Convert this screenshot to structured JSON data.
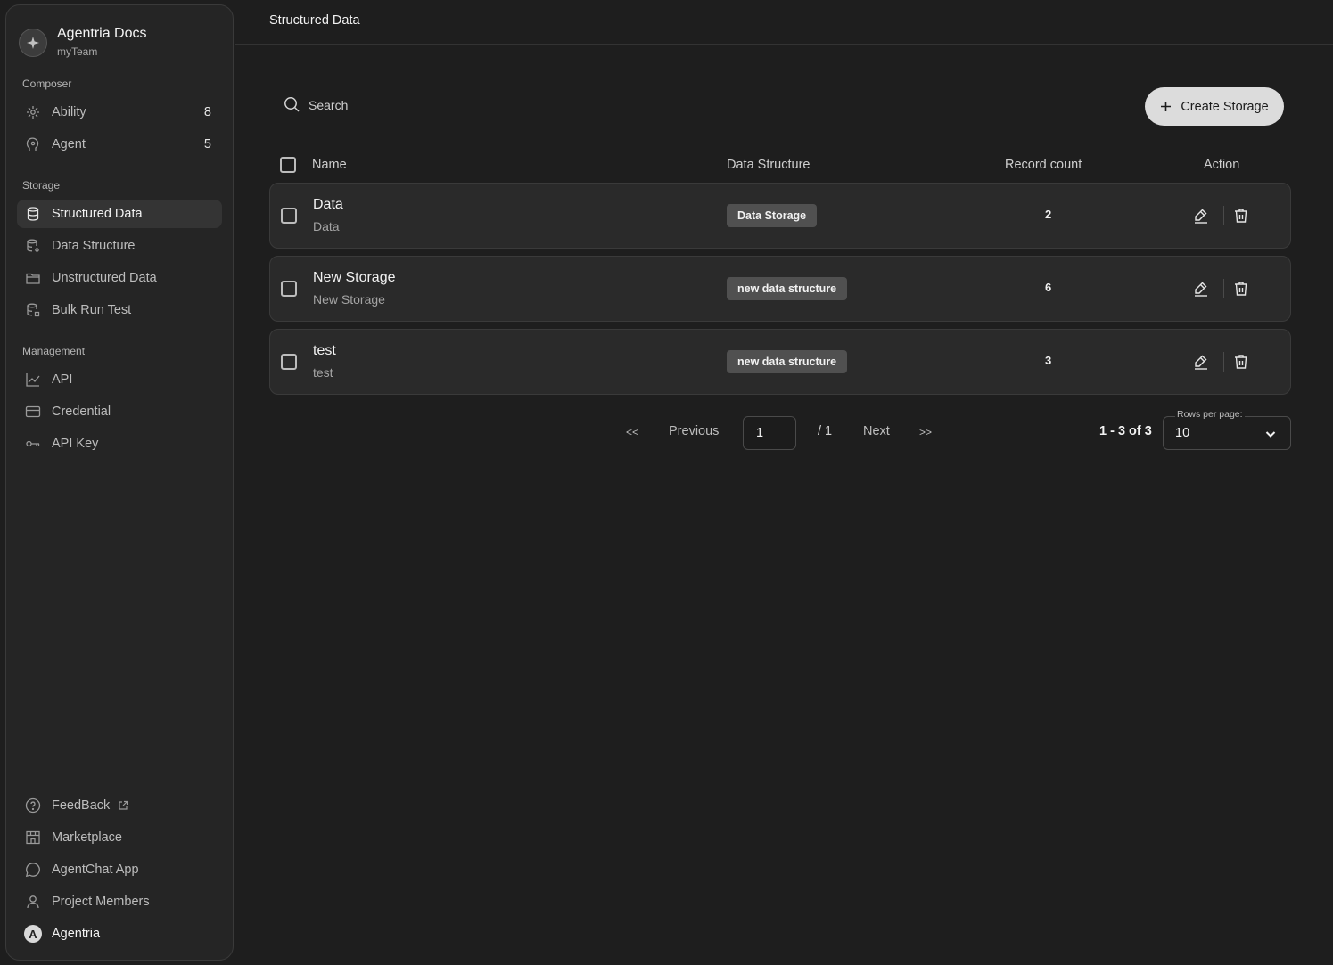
{
  "app": {
    "title": "Agentria Docs",
    "team": "myTeam"
  },
  "sidebar": {
    "composer_label": "Composer",
    "composer": [
      {
        "label": "Ability",
        "count": "8",
        "icon": "ability-icon"
      },
      {
        "label": "Agent",
        "count": "5",
        "icon": "agent-icon"
      }
    ],
    "storage_label": "Storage",
    "storage": [
      {
        "label": "Structured Data",
        "icon": "database-icon",
        "active": true
      },
      {
        "label": "Data Structure",
        "icon": "data-structure-icon"
      },
      {
        "label": "Unstructured Data",
        "icon": "folder-icon"
      },
      {
        "label": "Bulk Run Test",
        "icon": "bulk-run-icon"
      }
    ],
    "management_label": "Management",
    "management": [
      {
        "label": "API",
        "icon": "chart-icon"
      },
      {
        "label": "Credential",
        "icon": "credit-card-icon"
      },
      {
        "label": "API Key",
        "icon": "key-icon"
      }
    ],
    "footer": [
      {
        "label": "FeedBack",
        "icon": "help-circle-icon"
      },
      {
        "label": "Marketplace",
        "icon": "store-icon"
      },
      {
        "label": "AgentChat App",
        "icon": "chat-bubble-icon"
      },
      {
        "label": "Project Members",
        "icon": "user-icon"
      }
    ],
    "user": {
      "name": "Agentria",
      "initial": "A"
    }
  },
  "header": {
    "title": "Structured Data"
  },
  "toolbar": {
    "search_placeholder": "Search",
    "create_label": "Create Storage"
  },
  "table": {
    "columns": [
      "Name",
      "Data Structure",
      "Record count",
      "Action"
    ],
    "rows": [
      {
        "name": "Data",
        "description": "Data",
        "structure": "Data Storage",
        "count": "2"
      },
      {
        "name": "New Storage",
        "description": "New Storage",
        "structure": "new data structure",
        "count": "6"
      },
      {
        "name": "test",
        "description": "test",
        "structure": "new data structure",
        "count": "3"
      }
    ]
  },
  "pagination": {
    "first": "<<",
    "previous": "Previous",
    "current_page": "1",
    "total_pages": "/ 1",
    "next": "Next",
    "last": ">>",
    "range": "1 - 3 of 3",
    "rows_per_page_label": "Rows per page:",
    "rows_per_page": "10"
  },
  "colors": {
    "background": "#1e1e1e",
    "sidebar": "#252525",
    "row": "#2a2a2a",
    "tag": "#505050",
    "button": "#dcdcdc"
  }
}
